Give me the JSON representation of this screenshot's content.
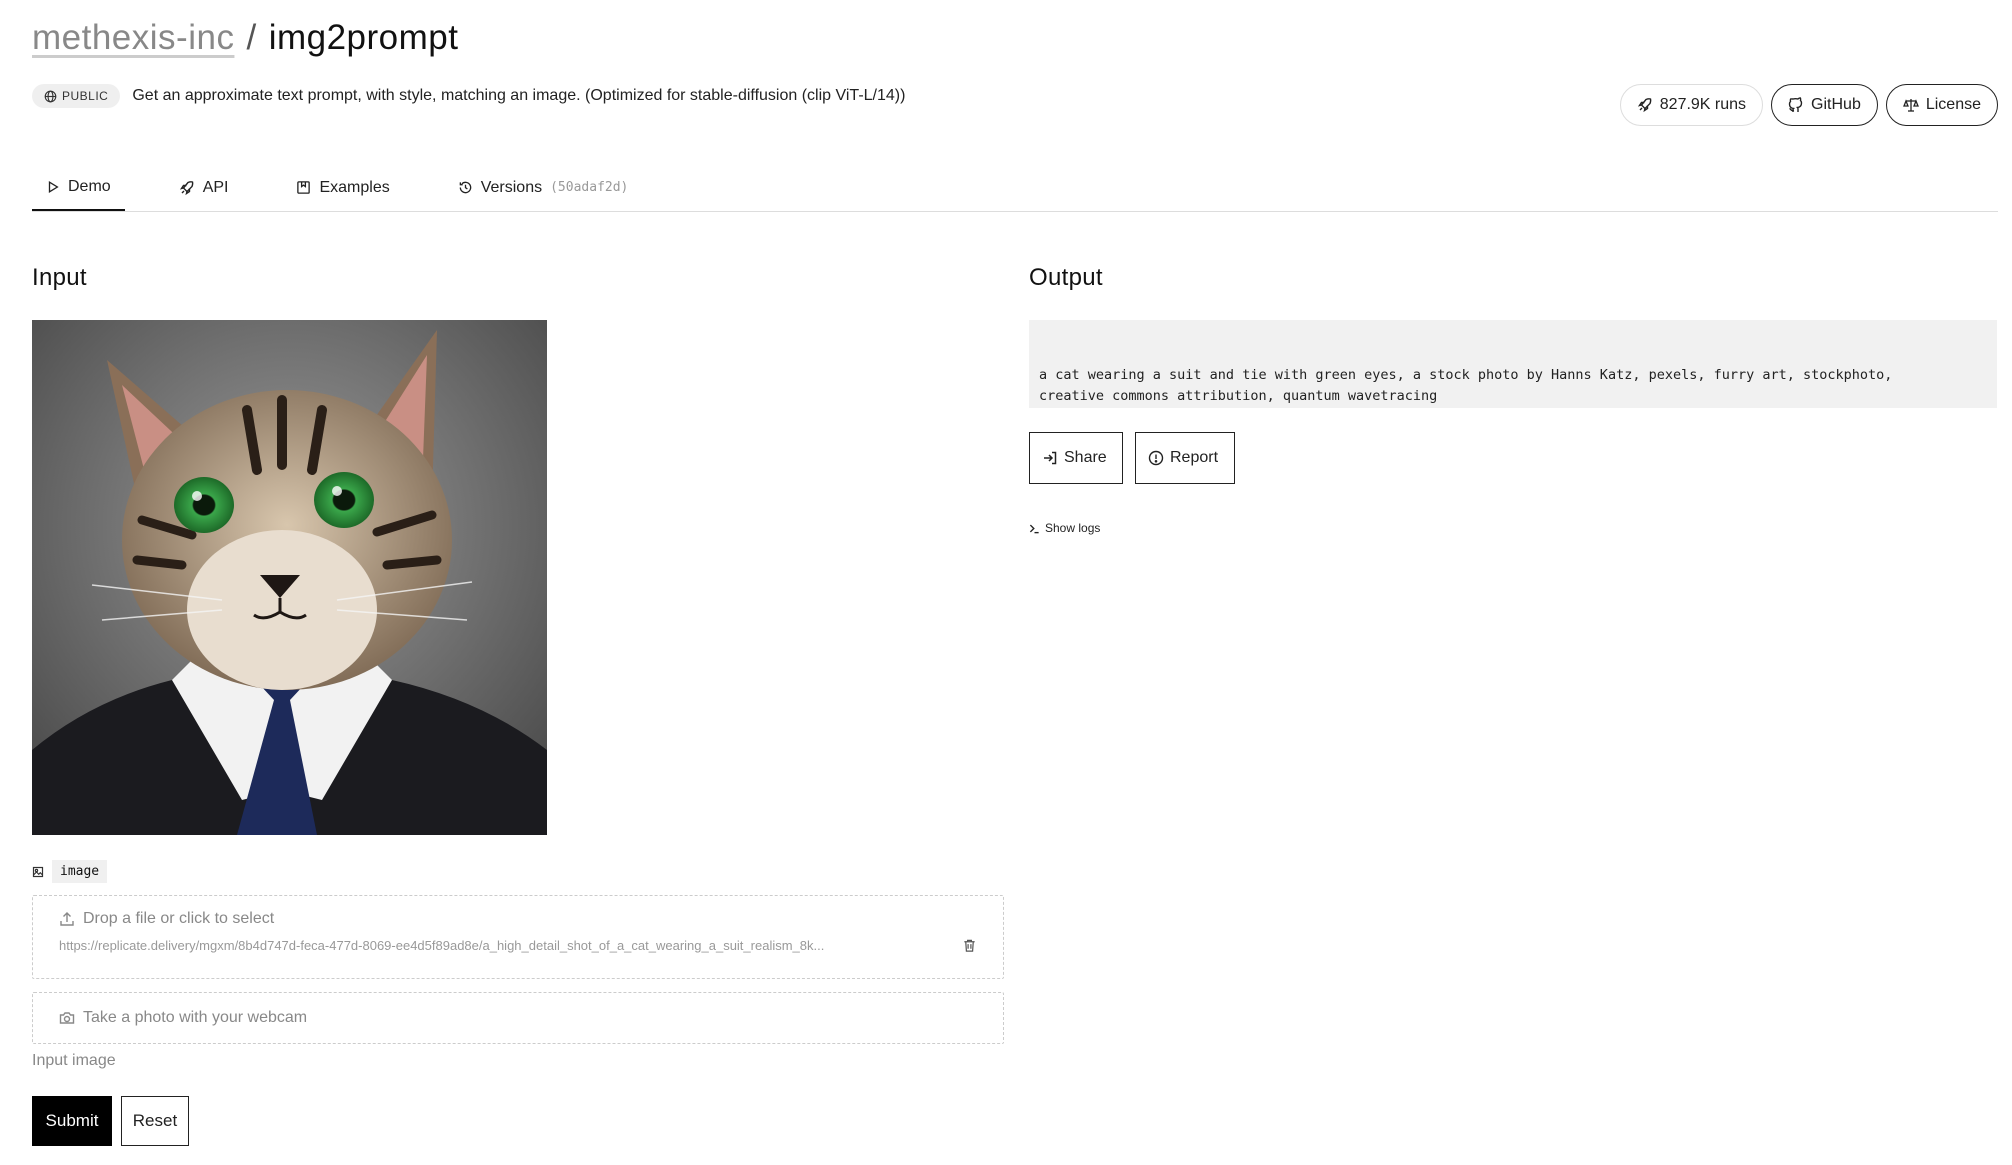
{
  "header": {
    "owner": "methexis-inc",
    "separator": "/",
    "model": "img2prompt",
    "visibility": "PUBLIC",
    "description": "Get an approximate text prompt, with style, matching an image. (Optimized for stable-diffusion (clip ViT-L/14))"
  },
  "pills": {
    "runs": "827.9K runs",
    "github": "GitHub",
    "license": "License"
  },
  "tabs": {
    "demo": "Demo",
    "api": "API",
    "examples": "Examples",
    "versions": "Versions",
    "version_hash": "(50adaf2d)"
  },
  "input": {
    "heading": "Input",
    "field_name": "image",
    "dropzone_label": "Drop a file or click to select",
    "file_url": "https://replicate.delivery/mgxm/8b4d747d-feca-477d-8069-ee4d5f89ad8e/a_high_detail_shot_of_a_cat_wearing_a_suit_realism_8k...",
    "webcam_label": "Take a photo with your webcam",
    "hint": "Input image",
    "submit": "Submit",
    "reset": "Reset"
  },
  "output": {
    "heading": "Output",
    "text": "a cat wearing a suit and tie with green eyes, a stock photo by Hanns Katz, pexels, furry art, stockphoto,\ncreative commons attribution, quantum wavetracing",
    "share": "Share",
    "report": "Report",
    "show_logs": "Show logs"
  },
  "icons": [
    "globe-icon",
    "rocket-icon",
    "github-icon",
    "scale-icon",
    "play-icon",
    "examples-icon",
    "history-icon",
    "image-icon",
    "upload-icon",
    "trash-icon",
    "camera-icon",
    "share-icon",
    "alert-icon",
    "terminal-icon"
  ]
}
